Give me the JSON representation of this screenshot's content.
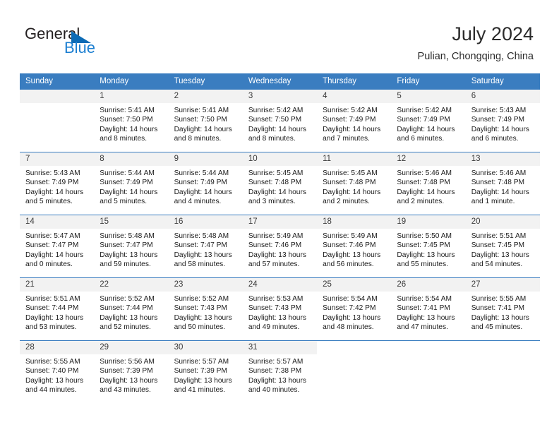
{
  "brand": {
    "name_part1": "General",
    "name_part2": "Blue",
    "accent_color": "#1c7fd1",
    "triangle_color": "#0d6bb5"
  },
  "header": {
    "month_title": "July 2024",
    "location": "Pulian, Chongqing, China"
  },
  "calendar": {
    "header_color": "#3a7dc0",
    "daynum_bg": "#f2f2f2",
    "weekdays": [
      "Sunday",
      "Monday",
      "Tuesday",
      "Wednesday",
      "Thursday",
      "Friday",
      "Saturday"
    ],
    "weeks": [
      [
        {
          "day": "",
          "sunrise": "",
          "sunset": "",
          "daylight1": "",
          "daylight2": "",
          "empty": true
        },
        {
          "day": "1",
          "sunrise": "Sunrise: 5:41 AM",
          "sunset": "Sunset: 7:50 PM",
          "daylight1": "Daylight: 14 hours",
          "daylight2": "and 8 minutes."
        },
        {
          "day": "2",
          "sunrise": "Sunrise: 5:41 AM",
          "sunset": "Sunset: 7:50 PM",
          "daylight1": "Daylight: 14 hours",
          "daylight2": "and 8 minutes."
        },
        {
          "day": "3",
          "sunrise": "Sunrise: 5:42 AM",
          "sunset": "Sunset: 7:50 PM",
          "daylight1": "Daylight: 14 hours",
          "daylight2": "and 8 minutes."
        },
        {
          "day": "4",
          "sunrise": "Sunrise: 5:42 AM",
          "sunset": "Sunset: 7:49 PM",
          "daylight1": "Daylight: 14 hours",
          "daylight2": "and 7 minutes."
        },
        {
          "day": "5",
          "sunrise": "Sunrise: 5:42 AM",
          "sunset": "Sunset: 7:49 PM",
          "daylight1": "Daylight: 14 hours",
          "daylight2": "and 6 minutes."
        },
        {
          "day": "6",
          "sunrise": "Sunrise: 5:43 AM",
          "sunset": "Sunset: 7:49 PM",
          "daylight1": "Daylight: 14 hours",
          "daylight2": "and 6 minutes."
        }
      ],
      [
        {
          "day": "7",
          "sunrise": "Sunrise: 5:43 AM",
          "sunset": "Sunset: 7:49 PM",
          "daylight1": "Daylight: 14 hours",
          "daylight2": "and 5 minutes."
        },
        {
          "day": "8",
          "sunrise": "Sunrise: 5:44 AM",
          "sunset": "Sunset: 7:49 PM",
          "daylight1": "Daylight: 14 hours",
          "daylight2": "and 5 minutes."
        },
        {
          "day": "9",
          "sunrise": "Sunrise: 5:44 AM",
          "sunset": "Sunset: 7:49 PM",
          "daylight1": "Daylight: 14 hours",
          "daylight2": "and 4 minutes."
        },
        {
          "day": "10",
          "sunrise": "Sunrise: 5:45 AM",
          "sunset": "Sunset: 7:48 PM",
          "daylight1": "Daylight: 14 hours",
          "daylight2": "and 3 minutes."
        },
        {
          "day": "11",
          "sunrise": "Sunrise: 5:45 AM",
          "sunset": "Sunset: 7:48 PM",
          "daylight1": "Daylight: 14 hours",
          "daylight2": "and 2 minutes."
        },
        {
          "day": "12",
          "sunrise": "Sunrise: 5:46 AM",
          "sunset": "Sunset: 7:48 PM",
          "daylight1": "Daylight: 14 hours",
          "daylight2": "and 2 minutes."
        },
        {
          "day": "13",
          "sunrise": "Sunrise: 5:46 AM",
          "sunset": "Sunset: 7:48 PM",
          "daylight1": "Daylight: 14 hours",
          "daylight2": "and 1 minute."
        }
      ],
      [
        {
          "day": "14",
          "sunrise": "Sunrise: 5:47 AM",
          "sunset": "Sunset: 7:47 PM",
          "daylight1": "Daylight: 14 hours",
          "daylight2": "and 0 minutes."
        },
        {
          "day": "15",
          "sunrise": "Sunrise: 5:48 AM",
          "sunset": "Sunset: 7:47 PM",
          "daylight1": "Daylight: 13 hours",
          "daylight2": "and 59 minutes."
        },
        {
          "day": "16",
          "sunrise": "Sunrise: 5:48 AM",
          "sunset": "Sunset: 7:47 PM",
          "daylight1": "Daylight: 13 hours",
          "daylight2": "and 58 minutes."
        },
        {
          "day": "17",
          "sunrise": "Sunrise: 5:49 AM",
          "sunset": "Sunset: 7:46 PM",
          "daylight1": "Daylight: 13 hours",
          "daylight2": "and 57 minutes."
        },
        {
          "day": "18",
          "sunrise": "Sunrise: 5:49 AM",
          "sunset": "Sunset: 7:46 PM",
          "daylight1": "Daylight: 13 hours",
          "daylight2": "and 56 minutes."
        },
        {
          "day": "19",
          "sunrise": "Sunrise: 5:50 AM",
          "sunset": "Sunset: 7:45 PM",
          "daylight1": "Daylight: 13 hours",
          "daylight2": "and 55 minutes."
        },
        {
          "day": "20",
          "sunrise": "Sunrise: 5:51 AM",
          "sunset": "Sunset: 7:45 PM",
          "daylight1": "Daylight: 13 hours",
          "daylight2": "and 54 minutes."
        }
      ],
      [
        {
          "day": "21",
          "sunrise": "Sunrise: 5:51 AM",
          "sunset": "Sunset: 7:44 PM",
          "daylight1": "Daylight: 13 hours",
          "daylight2": "and 53 minutes."
        },
        {
          "day": "22",
          "sunrise": "Sunrise: 5:52 AM",
          "sunset": "Sunset: 7:44 PM",
          "daylight1": "Daylight: 13 hours",
          "daylight2": "and 52 minutes."
        },
        {
          "day": "23",
          "sunrise": "Sunrise: 5:52 AM",
          "sunset": "Sunset: 7:43 PM",
          "daylight1": "Daylight: 13 hours",
          "daylight2": "and 50 minutes."
        },
        {
          "day": "24",
          "sunrise": "Sunrise: 5:53 AM",
          "sunset": "Sunset: 7:43 PM",
          "daylight1": "Daylight: 13 hours",
          "daylight2": "and 49 minutes."
        },
        {
          "day": "25",
          "sunrise": "Sunrise: 5:54 AM",
          "sunset": "Sunset: 7:42 PM",
          "daylight1": "Daylight: 13 hours",
          "daylight2": "and 48 minutes."
        },
        {
          "day": "26",
          "sunrise": "Sunrise: 5:54 AM",
          "sunset": "Sunset: 7:41 PM",
          "daylight1": "Daylight: 13 hours",
          "daylight2": "and 47 minutes."
        },
        {
          "day": "27",
          "sunrise": "Sunrise: 5:55 AM",
          "sunset": "Sunset: 7:41 PM",
          "daylight1": "Daylight: 13 hours",
          "daylight2": "and 45 minutes."
        }
      ],
      [
        {
          "day": "28",
          "sunrise": "Sunrise: 5:55 AM",
          "sunset": "Sunset: 7:40 PM",
          "daylight1": "Daylight: 13 hours",
          "daylight2": "and 44 minutes."
        },
        {
          "day": "29",
          "sunrise": "Sunrise: 5:56 AM",
          "sunset": "Sunset: 7:39 PM",
          "daylight1": "Daylight: 13 hours",
          "daylight2": "and 43 minutes."
        },
        {
          "day": "30",
          "sunrise": "Sunrise: 5:57 AM",
          "sunset": "Sunset: 7:39 PM",
          "daylight1": "Daylight: 13 hours",
          "daylight2": "and 41 minutes."
        },
        {
          "day": "31",
          "sunrise": "Sunrise: 5:57 AM",
          "sunset": "Sunset: 7:38 PM",
          "daylight1": "Daylight: 13 hours",
          "daylight2": "and 40 minutes."
        },
        {
          "day": "",
          "sunrise": "",
          "sunset": "",
          "daylight1": "",
          "daylight2": "",
          "blank": true
        },
        {
          "day": "",
          "sunrise": "",
          "sunset": "",
          "daylight1": "",
          "daylight2": "",
          "blank": true
        },
        {
          "day": "",
          "sunrise": "",
          "sunset": "",
          "daylight1": "",
          "daylight2": "",
          "blank": true
        }
      ]
    ]
  }
}
